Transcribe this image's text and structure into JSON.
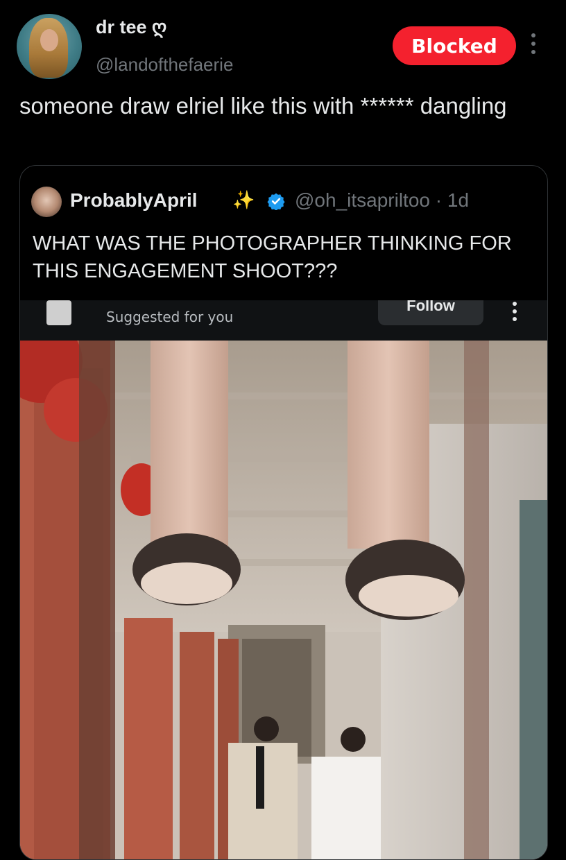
{
  "post": {
    "author": {
      "display_name": "dr tee ღ",
      "handle": "@landofthefaerie"
    },
    "blocked_label": "Blocked",
    "text": "someone draw elriel like this with ****** dangling"
  },
  "quoted_post": {
    "author": {
      "display_name": "ProbablyApril",
      "emoji": "✨",
      "handle": "@oh_itsapriltoo",
      "time": "· 1d"
    },
    "text": "WHAT WAS THE PHOTOGRAPHER THINKING FOR THIS ENGAGEMENT SHOOT???",
    "embedded": {
      "suggested_label": "Suggested for you",
      "follow_label": "Follow"
    }
  },
  "colors": {
    "background": "#000000",
    "blocked": "#f4212e",
    "verified": "#1d9bf0",
    "muted": "#71767b"
  },
  "icons": [
    "more-options-icon",
    "verified-badge-icon",
    "sparkles-emoji"
  ]
}
